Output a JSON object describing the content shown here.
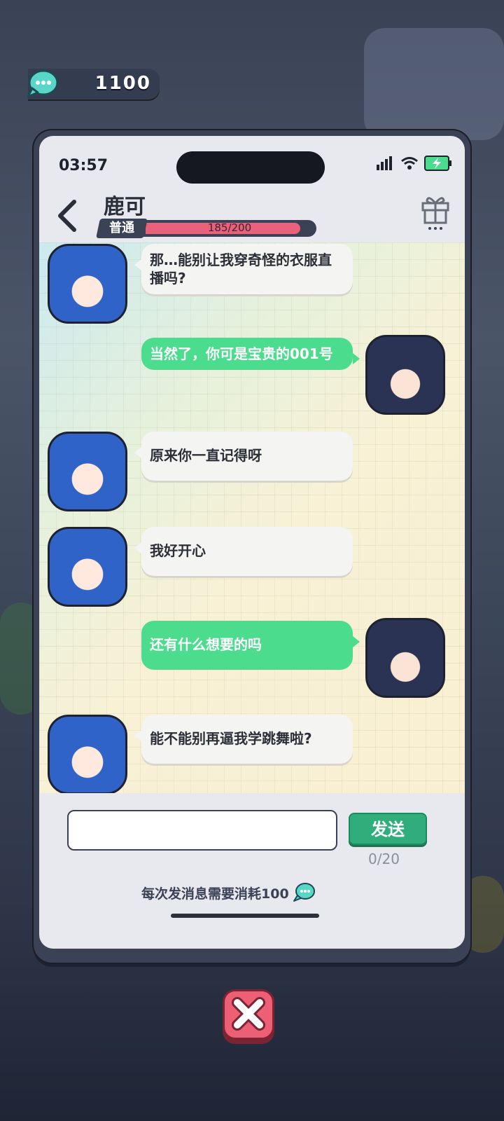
{
  "currency": {
    "amount": "1100",
    "icon": "chat-bubble-coin-icon"
  },
  "status_bar": {
    "time": "03:57",
    "icons": [
      "signal-icon",
      "wifi-icon",
      "battery-charging-icon"
    ]
  },
  "header": {
    "contact_name": "鹿可",
    "rank_label": "普通",
    "affection": {
      "current": 185,
      "max": 200,
      "text": "185/200"
    }
  },
  "messages": [
    {
      "sender": "contact",
      "text": "那…能别让我穿奇怪的衣服直播吗?"
    },
    {
      "sender": "me",
      "text": "当然了，你可是宝贵的001号"
    },
    {
      "sender": "contact",
      "text": "原来你一直记得呀"
    },
    {
      "sender": "contact",
      "text": "我好开心"
    },
    {
      "sender": "me",
      "text": "还有什么想要的吗"
    },
    {
      "sender": "contact",
      "text": "能不能别再逼我学跳舞啦?"
    }
  ],
  "composer": {
    "input_value": "",
    "send_label": "发送",
    "counter": "0/20",
    "cost_note": "每次发消息需要消耗100"
  },
  "colors": {
    "accent_green": "#2fae7c",
    "bubble_out": "#4bdc8e",
    "hp_fill": "#e9617a",
    "close_red": "#ec5f74"
  }
}
